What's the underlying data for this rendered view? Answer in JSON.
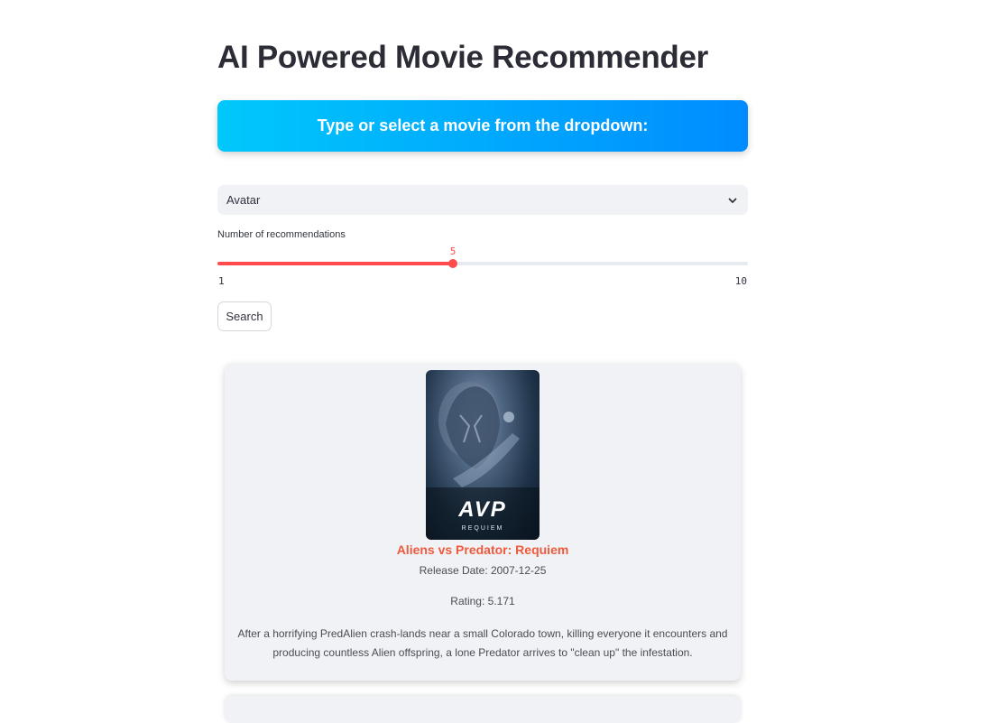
{
  "page": {
    "title": "AI Powered Movie Recommender"
  },
  "banner": {
    "text": "Type or select a movie from the dropdown:"
  },
  "movie_select": {
    "selected": "Avatar",
    "icon": "chevron-down-icon"
  },
  "slider": {
    "label": "Number of recommendations",
    "value": 5,
    "value_text": "5",
    "min": 1,
    "max": 10,
    "min_text": "1",
    "max_text": "10",
    "color": "#ff4b4b"
  },
  "search_button": {
    "label": "Search"
  },
  "recommendations": [
    {
      "title": "Aliens vs Predator: Requiem",
      "release_date": "Release Date: 2007-12-25",
      "rating": "Rating: 5.171",
      "overview": "After a horrifying PredAlien crash-lands near a small Colorado town, killing everyone it encounters and producing countless Alien offspring, a lone Predator arrives to \"clean up\" the infestation.",
      "poster": {
        "logo": "AVP",
        "subtitle": "REQUIEM"
      }
    }
  ],
  "colors": {
    "accent": "#ff4b4b",
    "title_accent": "#ef5a3c",
    "banner_start": "#00c8fb",
    "banner_end": "#008cff"
  }
}
